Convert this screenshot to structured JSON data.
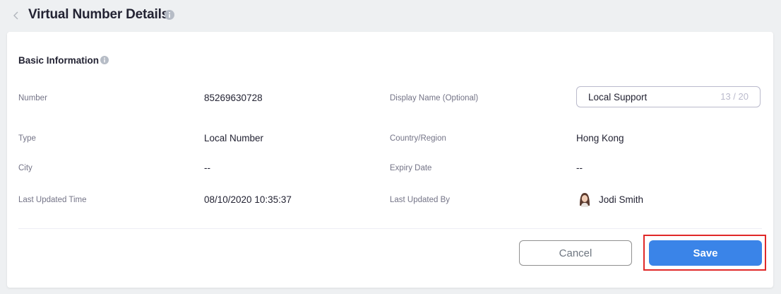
{
  "header": {
    "title": "Virtual Number Details",
    "back_icon": "chevron-left-icon",
    "info_icon": "info-icon"
  },
  "section": {
    "title": "Basic Information",
    "info_icon": "info-icon"
  },
  "fields": {
    "number": {
      "label": "Number",
      "value": "85269630728"
    },
    "display_name": {
      "label": "Display Name (Optional)",
      "value": "Local Support",
      "counter": "13 / 20"
    },
    "type": {
      "label": "Type",
      "value": "Local Number"
    },
    "country": {
      "label": "Country/Region",
      "value": "Hong Kong"
    },
    "city": {
      "label": "City",
      "value": "--"
    },
    "expiry": {
      "label": "Expiry Date",
      "value": "--"
    },
    "updated_time": {
      "label": "Last Updated Time",
      "value": "08/10/2020 10:35:37"
    },
    "updated_by": {
      "label": "Last Updated By",
      "value": "Jodi Smith",
      "avatar_icon": "user-avatar"
    }
  },
  "actions": {
    "cancel_label": "Cancel",
    "save_label": "Save"
  },
  "colors": {
    "primary": "#3a84e8",
    "highlight": "#e02828",
    "text": "#232333",
    "label": "#747487",
    "background": "#eef0f2"
  }
}
